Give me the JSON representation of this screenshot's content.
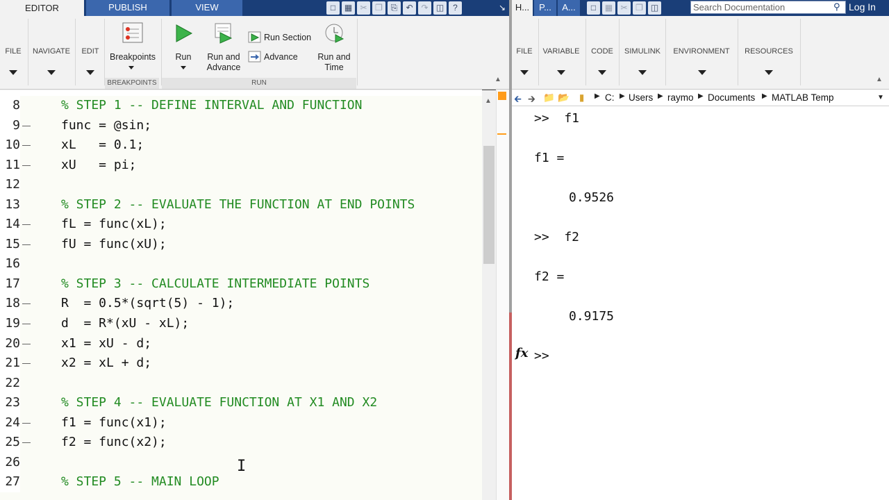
{
  "editor": {
    "tabs": [
      "EDITOR",
      "PUBLISH",
      "VIEW"
    ],
    "ribbon": {
      "file": "FILE",
      "navigate": "NAVIGATE",
      "edit": "EDIT",
      "breakpoints": "Breakpoints",
      "run": "Run",
      "run_and_advance": [
        "Run and",
        "Advance"
      ],
      "run_section": "Run Section",
      "advance": "Advance",
      "run_and_time": [
        "Run and",
        "Time"
      ],
      "section_breakpoints": "BREAKPOINTS",
      "section_run": "RUN"
    },
    "lines": [
      {
        "num": "8",
        "dash": false,
        "text": "% STEP 1 -- DEFINE INTERVAL AND FUNCTION",
        "comment": true
      },
      {
        "num": "9",
        "dash": true,
        "text": "func = @sin;",
        "comment": false
      },
      {
        "num": "10",
        "dash": true,
        "text": "xL   = 0.1;",
        "comment": false
      },
      {
        "num": "11",
        "dash": true,
        "text": "xU   = pi;",
        "comment": false
      },
      {
        "num": "12",
        "dash": false,
        "text": "",
        "comment": false
      },
      {
        "num": "13",
        "dash": false,
        "text": "% STEP 2 -- EVALUATE THE FUNCTION AT END POINTS",
        "comment": true
      },
      {
        "num": "14",
        "dash": true,
        "text": "fL = func(xL);",
        "comment": false
      },
      {
        "num": "15",
        "dash": true,
        "text": "fU = func(xU);",
        "comment": false
      },
      {
        "num": "16",
        "dash": false,
        "text": "",
        "comment": false
      },
      {
        "num": "17",
        "dash": false,
        "text": "% STEP 3 -- CALCULATE INTERMEDIATE POINTS",
        "comment": true
      },
      {
        "num": "18",
        "dash": true,
        "text": "R  = 0.5*(sqrt(5) - 1);",
        "comment": false
      },
      {
        "num": "19",
        "dash": true,
        "text": "d  = R*(xU - xL);",
        "comment": false
      },
      {
        "num": "20",
        "dash": true,
        "text": "x1 = xU - d;",
        "comment": false
      },
      {
        "num": "21",
        "dash": true,
        "text": "x2 = xL + d;",
        "comment": false
      },
      {
        "num": "22",
        "dash": false,
        "text": "",
        "comment": false
      },
      {
        "num": "23",
        "dash": false,
        "text": "% STEP 4 -- EVALUATE FUNCTION AT X1 AND X2",
        "comment": true
      },
      {
        "num": "24",
        "dash": true,
        "text": "f1 = func(x1);",
        "comment": false
      },
      {
        "num": "25",
        "dash": true,
        "text": "f2 = func(x2);",
        "comment": false
      },
      {
        "num": "26",
        "dash": false,
        "text": "",
        "comment": false
      },
      {
        "num": "27",
        "dash": false,
        "text": "% STEP 5 -- MAIN LOOP",
        "comment": true
      }
    ]
  },
  "command": {
    "tabs": [
      "H...",
      "P...",
      "A..."
    ],
    "search_placeholder": "Search Documentation",
    "login": "Log In",
    "ribbon": [
      "FILE",
      "VARIABLE",
      "CODE",
      "SIMULINK",
      "ENVIRONMENT",
      "RESOURCES"
    ],
    "path": [
      "C:",
      "Users",
      "raymo",
      "Documents",
      "MATLAB Temp"
    ],
    "output": [
      {
        "text": ">>  f1",
        "indent": false
      },
      {
        "text": "f1 =",
        "indent": false
      },
      {
        "text": "0.9526",
        "indent": true
      },
      {
        "text": ">>  f2",
        "indent": false
      },
      {
        "text": "f2 =",
        "indent": false
      },
      {
        "text": "0.9175",
        "indent": true
      },
      {
        "text": ">>",
        "indent": false
      }
    ],
    "fx": "fx"
  }
}
